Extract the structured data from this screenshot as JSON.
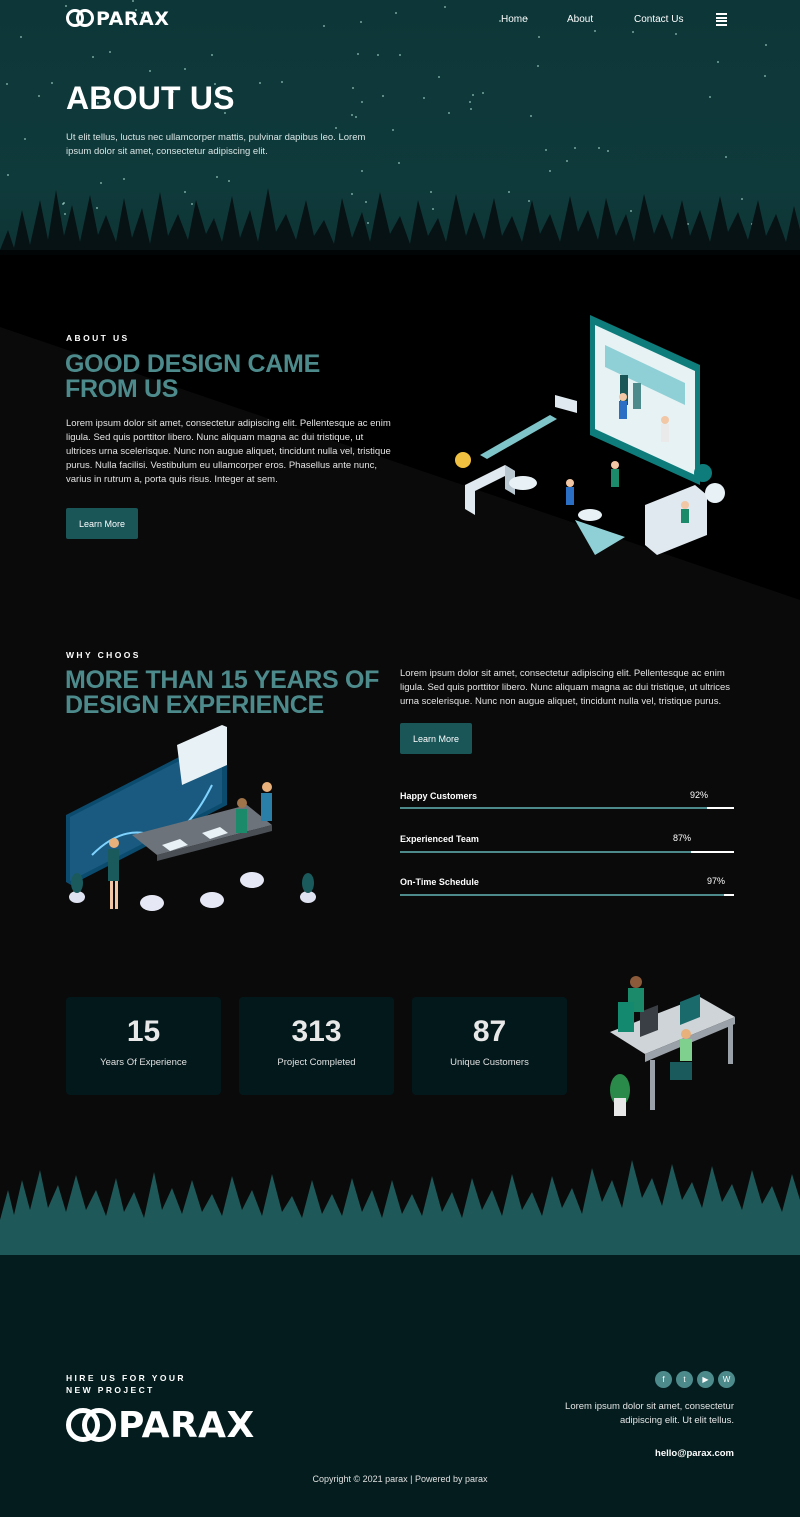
{
  "brand": {
    "logo_text": "PARAX"
  },
  "nav": {
    "items": [
      "Home",
      "About",
      "Contact Us"
    ]
  },
  "hero": {
    "title": "ABOUT US",
    "text": "Ut elit tellus, luctus nec ullamcorper mattis, pulvinar dapibus leo. Lorem ipsum dolor sit amet, consectetur adipiscing elit."
  },
  "about": {
    "eyebrow": "ABOUT US",
    "heading_line1": "GOOD DESIGN CAME",
    "heading_line2": "FROM US",
    "text": "Lorem ipsum dolor sit amet, consectetur adipiscing elit. Pellentesque ac enim ligula. Sed quis porttitor libero. Nunc aliquam magna ac dui tristique, ut ultrices urna scelerisque. Nunc non augue aliquet, tincidunt nulla vel, tristique purus. Nulla facilisi. Vestibulum eu ullamcorper eros. Phasellus ante nunc, varius in rutrum a, porta quis risus. Integer at sem.",
    "button": "Learn More"
  },
  "why": {
    "eyebrow": "WHY CHOOS",
    "heading_line1": "MORE THAN 15 YEARS OF",
    "heading_line2": "DESIGN EXPERIENCE",
    "text": "Lorem ipsum dolor sit amet, consectetur adipiscing elit. Pellentesque ac enim ligula. Sed quis porttitor libero. Nunc aliquam magna ac dui tristique, ut ultrices urna scelerisque. Nunc non augue aliquet, tincidunt nulla vel, tristique purus.",
    "button": "Learn More",
    "skills": [
      {
        "label": "Happy Customers",
        "percent": "92%",
        "value": 0.92
      },
      {
        "label": "Experienced Team",
        "percent": "87%",
        "value": 0.87
      },
      {
        "label": "On-Time Schedule",
        "percent": "97%",
        "value": 0.97
      }
    ]
  },
  "stats": [
    {
      "number": "15",
      "label": "Years Of Experience"
    },
    {
      "number": "313",
      "label": "Project Completed"
    },
    {
      "number": "87",
      "label": "Unique Customers"
    }
  ],
  "footer": {
    "cta_line1": "HIRE US FOR YOUR",
    "cta_line2": "NEW PROJECT",
    "text_line1": "Lorem ipsum dolor sit amet, consectetur",
    "text_line2": "adipiscing elit. Ut elit tellus.",
    "email": "hello@parax.com",
    "copyright": "Copyright © 2021 parax | Powered by parax",
    "social_icons": [
      "facebook-icon",
      "twitter-icon",
      "youtube-icon",
      "wordpress-icon"
    ]
  },
  "colors": {
    "accent": "#4d8a8c",
    "button": "#1a5558",
    "hero_bg": "#0f3a3b",
    "footer_bg": "#041c1e",
    "card_bg": "#03181b"
  }
}
